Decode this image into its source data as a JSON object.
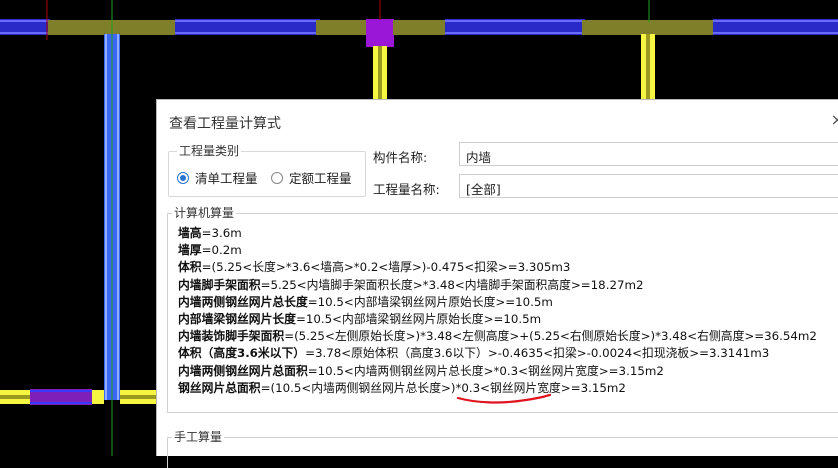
{
  "dialog": {
    "title": "查看工程量计算式",
    "close_symbol": "×",
    "qty_category": {
      "legend": "工程量类别",
      "options": [
        "清单工程量",
        "定额工程量"
      ],
      "selected": 0
    },
    "component_name_label": "构件名称:",
    "component_name_value": "内墙",
    "qty_name_label": "工程量名称:",
    "qty_name_value": "[全部]",
    "calc_section": {
      "legend": "计算机算量",
      "lines": [
        {
          "name": "墙高",
          "expr": "=3.6m"
        },
        {
          "name": "墙厚",
          "expr": "=0.2m"
        },
        {
          "name": "体积",
          "expr": "=(5.25<长度>*3.6<墙高>*0.2<墙厚>)-0.475<扣梁>=3.305m3"
        },
        {
          "name": "内墙脚手架面积",
          "expr": "=5.25<内墙脚手架面积长度>*3.48<内墙脚手架面积高度>=18.27m2"
        },
        {
          "name": "内墙两侧钢丝网片总长度",
          "expr": "=10.5<内部墙梁钢丝网片原始长度>=10.5m"
        },
        {
          "name": "内部墙梁钢丝网片长度",
          "expr": "=10.5<内部墙梁钢丝网片原始长度>=10.5m"
        },
        {
          "name": "内墙装饰脚手架面积",
          "expr": "=(5.25<左侧原始长度>)*3.48<左侧高度>+(5.25<右侧原始长度>)*3.48<右侧高度>=36.54m2"
        },
        {
          "name": "体积（高度3.6米以下）",
          "expr": "=3.78<原始体积（高度3.6以下）>-0.4635<扣梁>-0.0024<扣现浇板>=3.3141m3"
        },
        {
          "name": "内墙两侧钢丝网片总面积",
          "expr": "=10.5<内墙两侧钢丝网片总长度>*0.3<钢丝网片宽度>=3.15m2"
        },
        {
          "name": "钢丝网片总面积",
          "expr": "=(10.5<内墙两侧钢丝网片总长度>)*0.3<钢丝网片宽度>=3.15m2"
        }
      ]
    },
    "manual_section": {
      "legend": "手工算量"
    }
  },
  "colors": {
    "beam_olive": "#7f7f2a",
    "wall_blue": "#3a3aff",
    "wall_yellow": "#f5f542",
    "column_purple": "#9a17d8",
    "axis_green": "#1fa01f",
    "annotation_red": "#e0141e",
    "radio_blue": "#2b73d1"
  }
}
